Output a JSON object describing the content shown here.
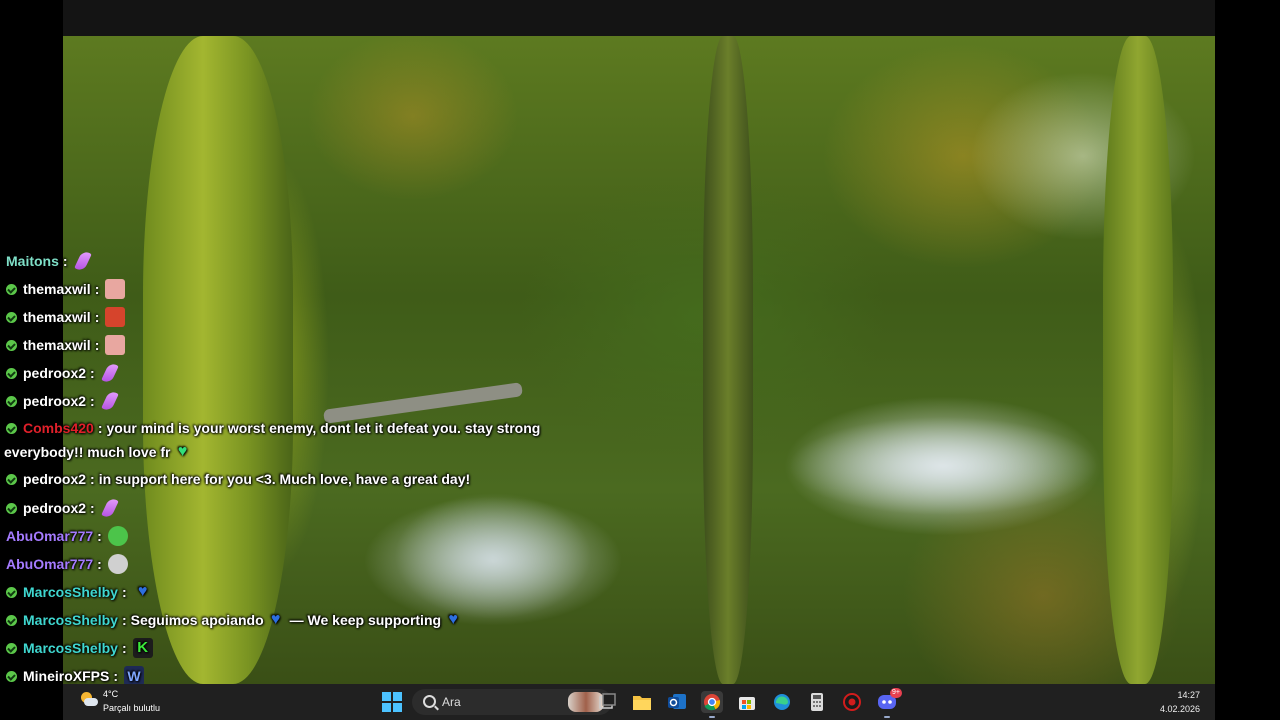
{
  "chat": {
    "messages": [
      {
        "user": "Maitons",
        "user_color": "#7fe0c8",
        "badge": false,
        "text": "",
        "emotes": [
          "feather-emote"
        ]
      },
      {
        "user": "themaxwil",
        "user_color": "#ffffff",
        "badge": true,
        "text": "",
        "emotes": [
          "pig-emote"
        ]
      },
      {
        "user": "themaxwil",
        "user_color": "#ffffff",
        "badge": true,
        "text": "",
        "emotes": [
          "angry-emote"
        ]
      },
      {
        "user": "themaxwil",
        "user_color": "#ffffff",
        "badge": true,
        "text": "",
        "emotes": [
          "pig-emote"
        ]
      },
      {
        "user": "pedroox2",
        "user_color": "#ffffff",
        "badge": true,
        "text": "",
        "emotes": [
          "feather-emote"
        ]
      },
      {
        "user": "pedroox2",
        "user_color": "#ffffff",
        "badge": true,
        "text": "",
        "emotes": [
          "feather-emote"
        ]
      },
      {
        "user": "Combs420",
        "user_color": "#e0202a",
        "badge": true,
        "text": "your mind is your worst enemy, dont let it defeat you. stay strong",
        "continuation": "everybody!! much love fr",
        "emotes": [
          "green-heart-emote"
        ]
      },
      {
        "user": "pedroox2",
        "user_color": "#ffffff",
        "badge": true,
        "text": "in support here for you <3. Much love, have a great day!",
        "emotes": []
      },
      {
        "user": "pedroox2",
        "user_color": "#ffffff",
        "badge": true,
        "text": "",
        "emotes": [
          "feather-emote"
        ]
      },
      {
        "user": "AbuOmar777",
        "user_color": "#a57bff",
        "badge": false,
        "text": "",
        "emotes": [
          "frog-emote"
        ]
      },
      {
        "user": "AbuOmar777",
        "user_color": "#a57bff",
        "badge": false,
        "text": "",
        "emotes": [
          "skull-emote"
        ]
      },
      {
        "user": "MarcosShelby",
        "user_color": "#3fd7d0",
        "badge": true,
        "text": "",
        "emotes": [
          "blue-heart-emote"
        ]
      },
      {
        "user": "MarcosShelby",
        "user_color": "#3fd7d0",
        "badge": true,
        "text": "Seguimos apoiando",
        "text2": "— We keep supporting",
        "emotes": [
          "blue-heart-emote",
          "blue-heart-emote"
        ]
      },
      {
        "user": "MarcosShelby",
        "user_color": "#3fd7d0",
        "badge": true,
        "text": "",
        "emotes": [
          "k-emote"
        ]
      },
      {
        "user": "MineiroXFPS",
        "user_color": "#ffffff",
        "badge": true,
        "text": "",
        "emotes": [
          "w-emote"
        ]
      }
    ],
    "emote_text": {
      "k": "K",
      "w": "W",
      "heart": "♥"
    },
    "separator": ":"
  },
  "taskbar": {
    "weather_temp": "4°C",
    "weather_desc": "Parçalı bulutlu",
    "search_placeholder": "Ara",
    "time": "14:27",
    "date": "4.02.2026",
    "discord_badge": "9+"
  }
}
